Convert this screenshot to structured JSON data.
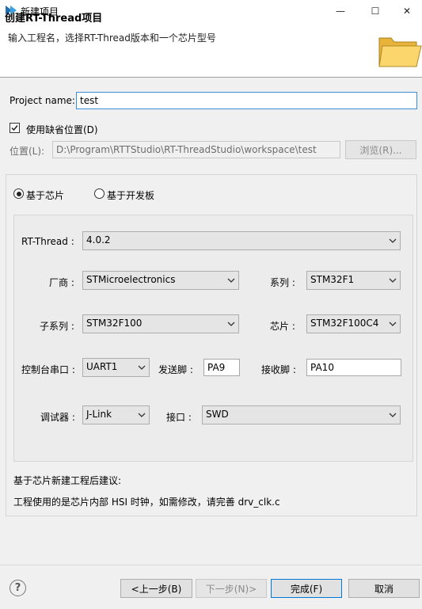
{
  "window": {
    "title": "新建项目",
    "minimize": "—",
    "maximize": "☐",
    "close": "✕"
  },
  "header": {
    "title": "创建RT-Thread项目",
    "description": "输入工程名，选择RT-Thread版本和一个芯片型号"
  },
  "project": {
    "name_label": "Project name:",
    "name_value": "test",
    "use_default_label": "使用缺省位置(D)",
    "use_default_checked": true,
    "location_label": "位置(L):",
    "location_value": "D:\\Program\\RTTStudio\\RT-ThreadStudio\\workspace\\test",
    "browse_label": "浏览(R)..."
  },
  "mode": {
    "chip_label": "基于芯片",
    "board_label": "基于开发板",
    "selected": "chip"
  },
  "config": {
    "rtthread_label": "RT-Thread :",
    "rtthread_value": "4.0.2",
    "vendor_label": "厂商 :",
    "vendor_value": "STMicroelectronics",
    "series_label": "系列 :",
    "series_value": "STM32F1",
    "subseries_label": "子系列 :",
    "subseries_value": "STM32F100",
    "chip_label": "芯片 :",
    "chip_value": "STM32F100C4",
    "console_label": "控制台串口 :",
    "console_value": "UART1",
    "tx_label": "发送脚 :",
    "tx_value": "PA9",
    "rx_label": "接收脚 :",
    "rx_value": "PA10",
    "debugger_label": "调试器 :",
    "debugger_value": "J-Link",
    "interface_label": "接口 :",
    "interface_value": "SWD"
  },
  "advice": {
    "title": "基于芯片新建工程后建议:",
    "text": "工程使用的是芯片内部 HSI 时钟，如需修改，请完善 drv_clk.c"
  },
  "footer": {
    "help_icon": "?",
    "back_label": "<上一步(B)",
    "next_label": "下一步(N)>",
    "finish_label": "完成(F)",
    "cancel_label": "取消"
  },
  "icons": [
    "app-logo-icon",
    "folder-icon",
    "chevron-down-icon",
    "check-icon",
    "help-icon"
  ],
  "colors": {
    "focus_border": "#3c8fd6",
    "default_button_border": "#0078d7",
    "folder_yellow": "#f5c542"
  }
}
